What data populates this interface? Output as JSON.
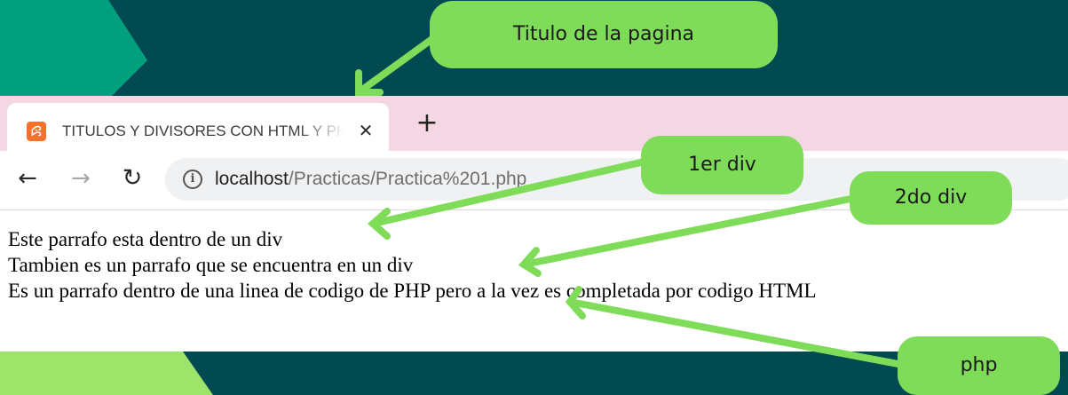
{
  "browser": {
    "tab": {
      "title": "TITULOS Y DIVISORES CON HTML Y PHP",
      "favicon_glyph": "ꕸ",
      "close_glyph": "✕"
    },
    "new_tab_glyph": "+",
    "nav": {
      "back_glyph": "←",
      "forward_glyph": "→",
      "reload_glyph": "↻"
    },
    "address": {
      "info_glyph": "i",
      "host": "localhost",
      "path": "/Practicas/Practica%201.php"
    }
  },
  "page": {
    "paragraphs": [
      "Este parrafo esta dentro de un div",
      "Tambien es un parrafo que se encuentra en un div",
      "Es un parrafo dentro de una linea de codigo de PHP pero a la vez es completada por codigo HTML"
    ]
  },
  "annotations": {
    "title_label": "Titulo de la pagina",
    "div1_label": "1er div",
    "div2_label": "2do div",
    "php_label": "php"
  },
  "colors": {
    "background": "#024a52",
    "teal_shape": "#00a07e",
    "lime_shape": "#9ee36a",
    "callout": "#7fdc59",
    "tabstrip": "#f5d7e4"
  }
}
